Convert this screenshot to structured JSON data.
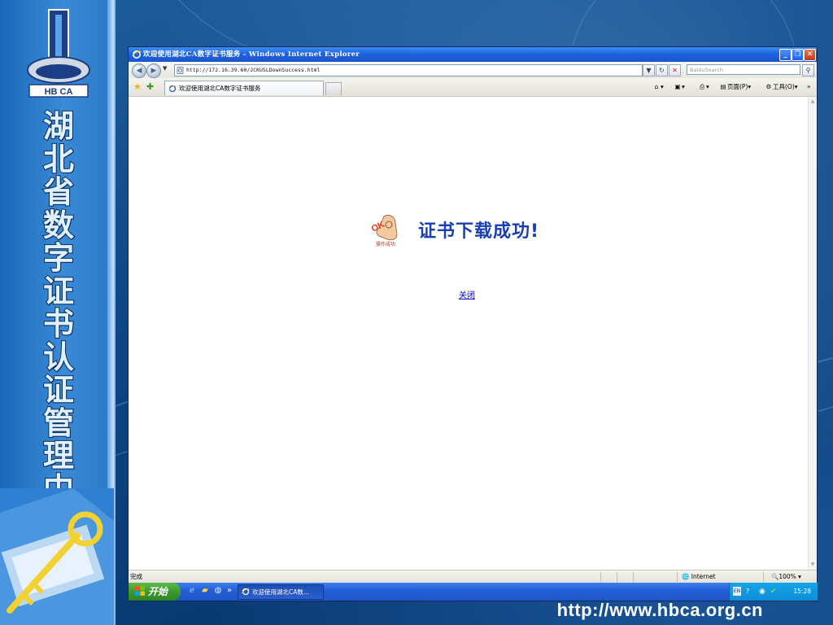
{
  "slide": {
    "vertical_title": "湖北省数字证书认证管理中心",
    "logo_text": "HB CA",
    "footer_url": "http://www.hbca.org.cn"
  },
  "browser": {
    "window_title": "欢迎使用湖北CA数字证书服务 - Windows Internet Explorer",
    "url": "http://172.16.39.60/JCKUSLDownSuccess.html",
    "search_placeholder": "BaiduSearch",
    "tab_title": "欢迎使用湖北CA数字证书服务",
    "commands": {
      "page": "页面(P)",
      "tools": "工具(O)"
    }
  },
  "page": {
    "badge_text": "操作成功",
    "success_message": "证书下载成功!",
    "close_link": "关闭"
  },
  "status": {
    "text": "完成",
    "zone": "Internet",
    "zoom": "100%"
  },
  "taskbar": {
    "start_label": "开始",
    "task_item": "欢迎使用湖北CA数...",
    "lang": "EN",
    "clock": "15:28"
  },
  "colors": {
    "success_title": "#1a3fb5",
    "link": "#0000cc",
    "titlebar": "#1f63e0",
    "slide_bg": "#0a3f7a"
  }
}
